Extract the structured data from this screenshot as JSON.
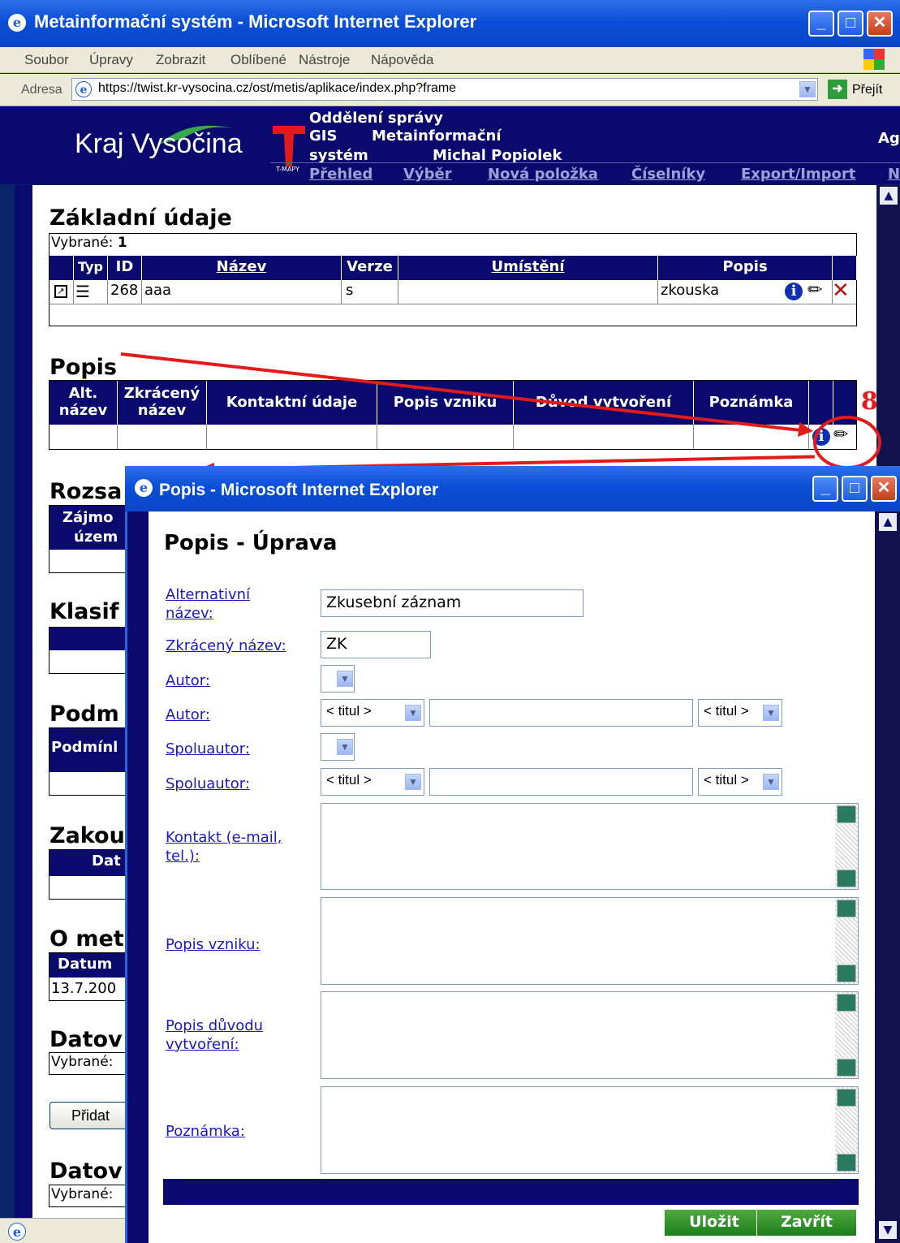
{
  "browser": {
    "title": "Metainformační systém - Microsoft Internet Explorer",
    "menu": [
      "Soubor",
      "Úpravy",
      "Zobrazit",
      "Oblíbené",
      "Nástroje",
      "Nápověda"
    ],
    "address_label": "Adresa",
    "url": "https://twist.kr-vysocina.cz/ost/metis/aplikace/index.php?frame",
    "go_label": "Přejít"
  },
  "header": {
    "logo": "Kraj Vysočina",
    "tmapy": "T-MAPY",
    "dept_line1": "Oddělení správy",
    "dept_line2": "GIS",
    "app_line1": "Metainformační",
    "app_line2": "systém",
    "user": "Michal Popiolek",
    "right_text": "Ag",
    "nav": [
      "Přehled",
      "Výběr",
      "Nová položka",
      "Číselníky",
      "Export/Import",
      "N"
    ]
  },
  "basic": {
    "heading": "Základní údaje",
    "selected_label": "Vybrané:",
    "selected_count": "1",
    "columns": [
      "Typ",
      "ID",
      "Název",
      "Verze",
      "Umístění",
      "Popis"
    ],
    "row": {
      "id": "268",
      "name": "aaa",
      "version": "s",
      "location": "",
      "description": "zkouska"
    }
  },
  "popis": {
    "heading": "Popis",
    "col_alt": [
      "Alt.",
      "název"
    ],
    "col_short": [
      "Zkrácený",
      "název"
    ],
    "columns": [
      "Kontaktní údaje",
      "Popis vzniku",
      "Důvod vytvoření",
      "Poznámka"
    ]
  },
  "annotation": {
    "number": "8"
  },
  "background_sections": {
    "rozsah": "Rozsa",
    "zajmove": [
      "Zájmo",
      "územ"
    ],
    "klasif": "Klasif",
    "podm": "Podm",
    "podminky": "Podmínl",
    "zakou": "Zakou",
    "dat": "Dat",
    "omet": "O met",
    "datum": "Datum",
    "date": "13.7.200",
    "datov1": "Datov",
    "vybrane1": "Vybrané:",
    "pridat": "Přidat",
    "datov2": "Datov",
    "vybrane2": "Vybrané:"
  },
  "dialog": {
    "title": "Popis - Microsoft Internet Explorer",
    "heading": "Popis - Úprava",
    "fields": {
      "alt_label": [
        "Alternativní",
        "název:"
      ],
      "alt_value": "Zkusební záznam",
      "short_label": "Zkrácený název:",
      "short_value": "ZK",
      "autor1_label": "Autor:",
      "autor2_label": "Autor:",
      "spolu1_label": "Spoluautor:",
      "spolu2_label": "Spoluautor:",
      "titul": "< titul >",
      "kontakt_label": [
        "Kontakt (e-mail,",
        "tel.):"
      ],
      "vznik_label": "Popis vzniku:",
      "duvod_label": [
        "Popis důvodu",
        "vytvoření:"
      ],
      "poznamka_label": "Poznámka:"
    },
    "save": "Uložit",
    "close": "Zavřít"
  }
}
